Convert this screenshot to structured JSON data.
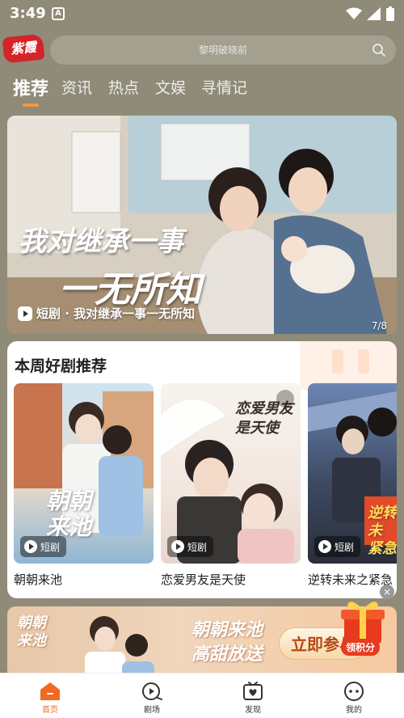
{
  "status_bar": {
    "time": "3:49",
    "indicator": "A"
  },
  "header": {
    "logo_text": "紫霞",
    "search_placeholder": "黎明破晓前"
  },
  "tabs": [
    {
      "label": "推荐",
      "active": true
    },
    {
      "label": "资讯",
      "active": false
    },
    {
      "label": "热点",
      "active": false
    },
    {
      "label": "文娱",
      "active": false
    },
    {
      "label": "寻情记",
      "active": false
    }
  ],
  "banner": {
    "title_line1": "我对继承一事",
    "title_line2": "一无所知",
    "caption": "短剧 · 我对继承一事一无所知",
    "counter": "7/8"
  },
  "weekly": {
    "title": "本周好剧推荐",
    "items": [
      {
        "name": "朝朝来池",
        "badge": "短剧",
        "art_text": "朝朝\n来池"
      },
      {
        "name": "恋爱男友是天使",
        "badge": "短剧",
        "art_text": "恋爱男友\n是天使"
      },
      {
        "name": "逆转未来之紧急",
        "badge": "短剧",
        "art_text": "逆转未\n紧急"
      }
    ]
  },
  "ad": {
    "left_text": "朝朝\n来池",
    "slogan_line1": "朝朝来池",
    "slogan_line2": "高甜放送",
    "cta": "立即参与",
    "gift_label": "领积分",
    "close": "×"
  },
  "bottom_nav": [
    {
      "label": "首页",
      "icon": "home-icon",
      "active": true
    },
    {
      "label": "剧场",
      "icon": "theater-icon",
      "active": false
    },
    {
      "label": "发现",
      "icon": "discover-icon",
      "active": false
    },
    {
      "label": "我的",
      "icon": "profile-icon",
      "active": false
    }
  ],
  "colors": {
    "accent": "#f06a22",
    "header_bg": "#8f8b78",
    "indicator": "#f39a3a"
  }
}
